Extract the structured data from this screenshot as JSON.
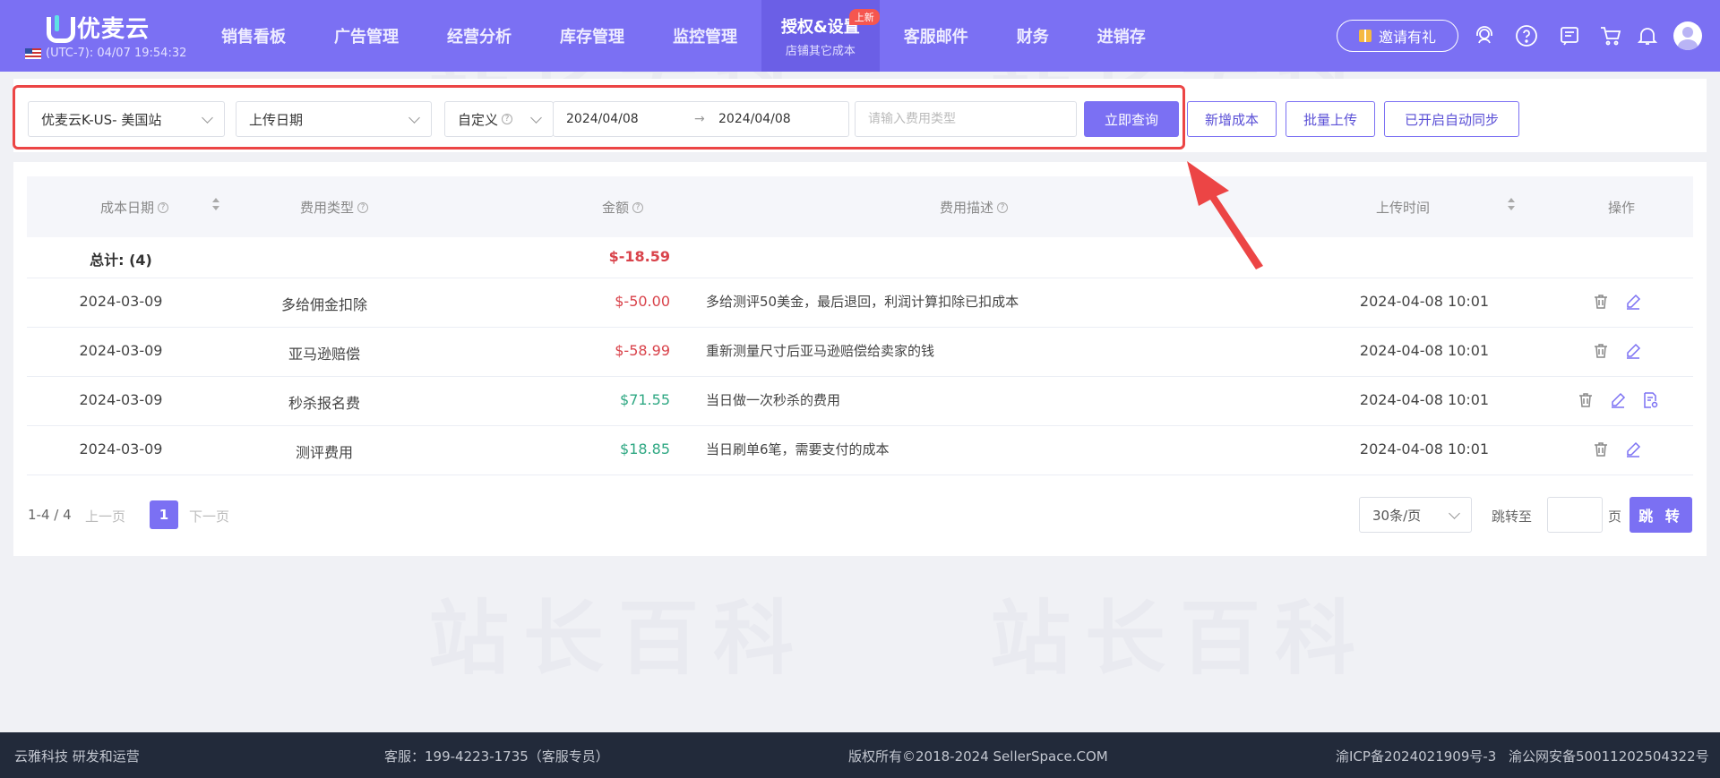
{
  "header": {
    "logo_text": "优麦云",
    "timezone": "(UTC-7): 04/07 19:54:32",
    "nav": [
      {
        "label": "销售看板"
      },
      {
        "label": "广告管理"
      },
      {
        "label": "经营分析"
      },
      {
        "label": "库存管理"
      },
      {
        "label": "监控管理"
      },
      {
        "label": "授权&设置",
        "sub": "店铺其它成本",
        "badge": "上新",
        "active": true
      },
      {
        "label": "客服邮件"
      },
      {
        "label": "财务"
      },
      {
        "label": "进销存"
      }
    ],
    "invite_label": "邀请有礼"
  },
  "filters": {
    "shop": "优麦云K-US- 美国站",
    "date_field": "上传日期",
    "range_mode": "自定义",
    "date_start": "2024/04/08",
    "date_sep": "→",
    "date_end": "2024/04/08",
    "fee_type_placeholder": "请输入费用类型",
    "query_button": "立即查询",
    "add_button": "新增成本",
    "batch_button": "批量上传",
    "sync_button": "已开启自动同步"
  },
  "table": {
    "columns": {
      "date": "成本日期",
      "type": "费用类型",
      "amount": "金额",
      "desc": "费用描述",
      "upload_time": "上传时间",
      "ops": "操作"
    },
    "total": {
      "label": "总计: (4)",
      "amount": "$-18.59"
    },
    "rows": [
      {
        "date": "2024-03-09",
        "type": "多给佣金扣除",
        "amount": "$-50.00",
        "sign": "neg",
        "desc": "多给测评50美金，最后退回，利润计算扣除已扣成本",
        "upload_time": "2024-04-08 10:01"
      },
      {
        "date": "2024-03-09",
        "type": "亚马逊赔偿",
        "amount": "$-58.99",
        "sign": "neg",
        "desc": "重新测量尺寸后亚马逊赔偿给卖家的钱",
        "upload_time": "2024-04-08 10:01"
      },
      {
        "date": "2024-03-09",
        "type": "秒杀报名费",
        "amount": "$71.55",
        "sign": "pos",
        "desc": "当日做一次秒杀的费用",
        "upload_time": "2024-04-08 10:01"
      },
      {
        "date": "2024-03-09",
        "type": "测评费用",
        "amount": "$18.85",
        "sign": "pos",
        "desc": "当日刷单6笔，需要支付的成本",
        "upload_time": "2024-04-08 10:01"
      }
    ]
  },
  "pagination": {
    "range": "1-4 / 4",
    "prev": "上一页",
    "current": "1",
    "next": "下一页",
    "page_size": "30条/页",
    "jump_to": "跳转至",
    "page_unit": "页",
    "jump_button": "跳 转"
  },
  "footer": {
    "company": "云雅科技 研发和运营",
    "service": "客服：199-4223-1735（客服专员）",
    "copyright": "版权所有©2018-2024 SellerSpace.COM",
    "icp": "渝ICP备2024021909号-3",
    "police": "渝公网安备50011202504322号"
  },
  "watermark": "站长百科",
  "colors": {
    "brand": "#7b70f3",
    "negative": "#d9434b",
    "positive": "#2fa883",
    "highlight": "#ec4545",
    "footer_bg": "#222a3a"
  }
}
